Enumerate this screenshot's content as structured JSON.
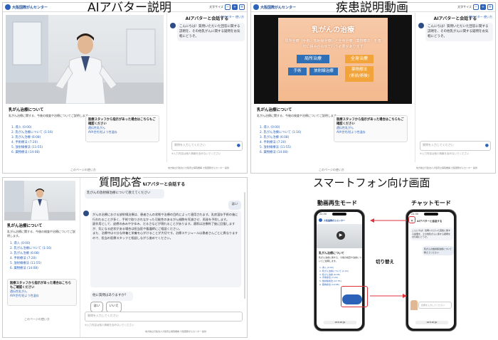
{
  "titles": {
    "q1": "AIアバター説明",
    "q2": "疾患説明動画",
    "q3": "質問応答",
    "q4": "スマートフォン向け画面"
  },
  "header": {
    "logo": "大阪国際がんセンター",
    "logo2": "OICI",
    "text_size_label": "文字サイズ"
  },
  "chat": {
    "title": "AIアバターと会話する",
    "sub": "AIアバター 使い方",
    "greeting": "こんにちは！質問いただいた回答に関する説明を、その他乳がんに関する疑問をお気軽にどうぞ。",
    "input_placeholder": "質問を入力してください",
    "input_note": "※入力内容は個人情報を含めないでください"
  },
  "video": {
    "slide_title": "乳がんの治療",
    "slide_text": "局所治療（手術、放射線治療）と全身治療（薬物療法）を適切に組み合わせて行う必要があります",
    "box_local": "局所治療",
    "box_systemic": "全身治療",
    "box_surgery": "手術",
    "box_radiation": "放射線治療",
    "box_drug": "薬物療法\n(術前/術後)"
  },
  "section": {
    "title": "乳がん治療について",
    "desc": "乳がん治療に関する、今後の検査や治療についてご説明します。",
    "chapters": [
      "1. 導入 (0:00)",
      "2. 乳がん治療について (1:16)",
      "3. 乳がん治療 (6:08)",
      "4. 手術療法 (7:20)",
      "5. 放射線療法 (11:55)",
      "6. 薬物療法 (14:08)"
    ]
  },
  "staff": {
    "title": "医療スタッフから指示があった場合はこちらもご確認ください",
    "links": [
      "遺伝性乳がん",
      "AYA世代/妊よう性温存"
    ]
  },
  "footer": {
    "back": "このページの使い方",
    "copyright": "地方独立行政法人大阪府立病院機構 大阪国際がんセンター 提供"
  },
  "qa": {
    "user_q": "乳がんの放射線治療について教えてください",
    "user_a": "はい",
    "answer": "がんの治療における放射線治療は、患者さんの状態や治療の目的によって適用されます。乳房温存手術の後に行われることが多く、手術で取りきれなかった可能性のあるがん細胞を死滅させ、再発を予防します。\n副作用として、皮膚の赤みやかゆみ、だるさなどが現れることがあります。通常は治療終了後に回復しますが、気になる症状がある場合は担当医や看護師にご相談ください。\nまた、治療中は十分な休養と栄養を心がけることが大切です。治療スケジュールは患者さんごとに異なりますので、担当の医療スタッフと相談しながら進めてください。",
    "followup": "他に質問はありますか？",
    "yes": "はい",
    "no": "いいえ"
  },
  "phone": {
    "mode_video": "動画再生モード",
    "mode_chat": "チャットモード",
    "switch": "切り替え",
    "time": "22:30",
    "url": "ocii-ai.jp"
  }
}
